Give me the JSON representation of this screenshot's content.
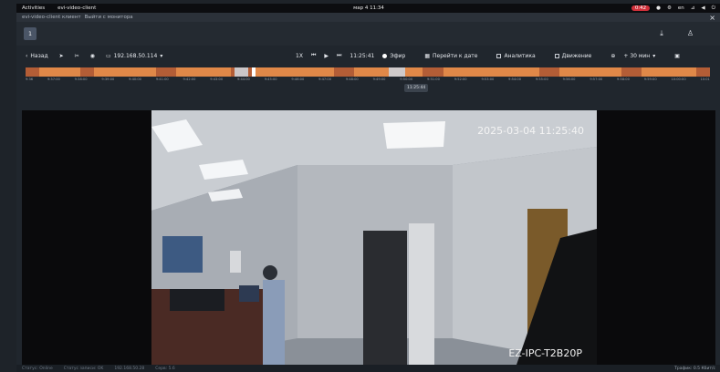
{
  "system": {
    "activities": "Activities",
    "app_name": "evi-video-client",
    "clock": "мар 4 11:34",
    "rec_badge": "0:42",
    "lang": "en"
  },
  "window": {
    "title": "evi-video-client клиент",
    "exit_monitor": "Выйти с монитора"
  },
  "tabs": [
    {
      "label": "1"
    }
  ],
  "toolbar": {
    "back_label": "Назад",
    "camera_ip": "192.168.50.114",
    "speed": "1X",
    "time": "11:25:41",
    "live_label": "Эфир",
    "goto_date": "Перейти к дате",
    "analytics_label": "Аналитика",
    "motion_label": "Движение",
    "interval": "+ 30 мин"
  },
  "timeline": {
    "cursor_time": "11:25:44",
    "ticks": [
      "9:36",
      "9:37:00",
      "9:38:00",
      "9:39:00",
      "9:40:00",
      "9:41:00",
      "9:42:00",
      "9:43:00",
      "9:44:00",
      "9:45:00",
      "9:46:00",
      "9:47:00",
      "9:48:00",
      "9:49:00",
      "9:50:00",
      "9:51:00",
      "9:52:00",
      "9:53:00",
      "9:54:00",
      "9:55:00",
      "9:56:00",
      "9:57:00",
      "9:58:00",
      "9:59:00",
      "10:00:00",
      "10:01"
    ]
  },
  "video": {
    "timestamp": "2025-03-04 11:25:40",
    "camera_name": "EZ-IPC-T2B20P"
  },
  "status": {
    "s1": "Статус: Online",
    "s2": "Статус записи: OK",
    "s3": "192.168.50.28",
    "s4": "Серв: 5.6",
    "zoom": "Трафик: 0.5 Кбит/с"
  },
  "colors": {
    "accent": "#e08848",
    "background": "#20262d"
  }
}
